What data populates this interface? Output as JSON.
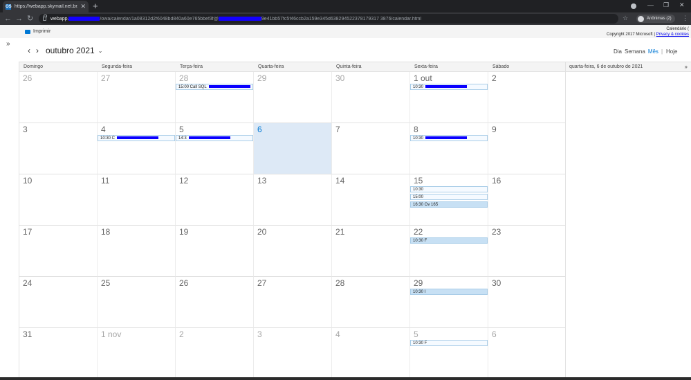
{
  "browser": {
    "tab_title": "https://webapp.skymail.net.br/o",
    "tab_favicon": "OS",
    "url_host": "webapp.",
    "url_path_1": "/owa/calendar/1a08312d2f6048bd840a60e765bbef3f@",
    "url_path_2": "9e41bb57fc5f46ccb2a159e345d638294522378179317 3876/calendar.html",
    "profile_label": "Anônimas (2)"
  },
  "app": {
    "print_label": "Imprimir",
    "brand_line1": "Calendário (",
    "brand_line2": "Copyright 2017 Microsoft |",
    "brand_link": "Privacy & cookies",
    "month_title": "outubro 2021",
    "views": {
      "day": "Dia",
      "week": "Semana",
      "month": "Mês",
      "today": "Hoje"
    },
    "weekdays": [
      "Domingo",
      "Segunda-feira",
      "Terça-feira",
      "Quarta-feira",
      "Quinta-feira",
      "Sexta-feira",
      "Sábado"
    ],
    "agenda_date": "quarta-feira, 6 de outubro de 2021"
  },
  "weeks": [
    [
      "26",
      "27",
      "28",
      "29",
      "30",
      "1 out",
      "2"
    ],
    [
      "3",
      "4",
      "5",
      "6",
      "7",
      "8",
      "9"
    ],
    [
      "10",
      "11",
      "12",
      "13",
      "14",
      "15",
      "16"
    ],
    [
      "17",
      "18",
      "19",
      "20",
      "21",
      "22",
      "23"
    ],
    [
      "24",
      "25",
      "26",
      "27",
      "28",
      "29",
      "30"
    ],
    [
      "31",
      "1 nov",
      "2",
      "3",
      "4",
      "5",
      "6"
    ]
  ],
  "events": [
    {
      "week": 0,
      "day": 2,
      "slot": 0,
      "text": "15:00 Call SQL",
      "redacted": true,
      "style": "light"
    },
    {
      "week": 0,
      "day": 5,
      "slot": 0,
      "text": "10:30",
      "redacted": true,
      "style": "light"
    },
    {
      "week": 1,
      "day": 1,
      "slot": 0,
      "text": "10:30 C",
      "redacted": true,
      "style": "light"
    },
    {
      "week": 1,
      "day": 2,
      "slot": 0,
      "text": "14:3",
      "redacted": true,
      "style": "light"
    },
    {
      "week": 1,
      "day": 5,
      "slot": 0,
      "text": "10:30",
      "redacted": true,
      "style": "light"
    },
    {
      "week": 2,
      "day": 5,
      "slot": 0,
      "text": "10:30",
      "redacted": false,
      "style": "light"
    },
    {
      "week": 2,
      "day": 5,
      "slot": 1,
      "text": "15:00",
      "redacted": false,
      "style": "light"
    },
    {
      "week": 2,
      "day": 5,
      "slot": 2,
      "text": "16:30 Ov        165",
      "redacted": false,
      "style": "solid"
    },
    {
      "week": 3,
      "day": 5,
      "slot": 0,
      "text": "10:30 F",
      "redacted": false,
      "style": "solid"
    },
    {
      "week": 4,
      "day": 5,
      "slot": 0,
      "text": "10:30 I",
      "redacted": false,
      "style": "solid"
    },
    {
      "week": 5,
      "day": 5,
      "slot": 0,
      "text": "10:30 F",
      "redacted": false,
      "style": "light"
    }
  ],
  "today": {
    "week": 1,
    "day": 3
  },
  "outside_days": [
    [
      0,
      0
    ],
    [
      0,
      1
    ],
    [
      0,
      2
    ],
    [
      0,
      3
    ],
    [
      0,
      4
    ],
    [
      5,
      1
    ],
    [
      5,
      2
    ],
    [
      5,
      3
    ],
    [
      5,
      4
    ],
    [
      5,
      5
    ],
    [
      5,
      6
    ]
  ],
  "colors": {
    "accent": "#0078d4",
    "event_fill": "#c7e0f4",
    "today_fill": "#dde9f6"
  }
}
